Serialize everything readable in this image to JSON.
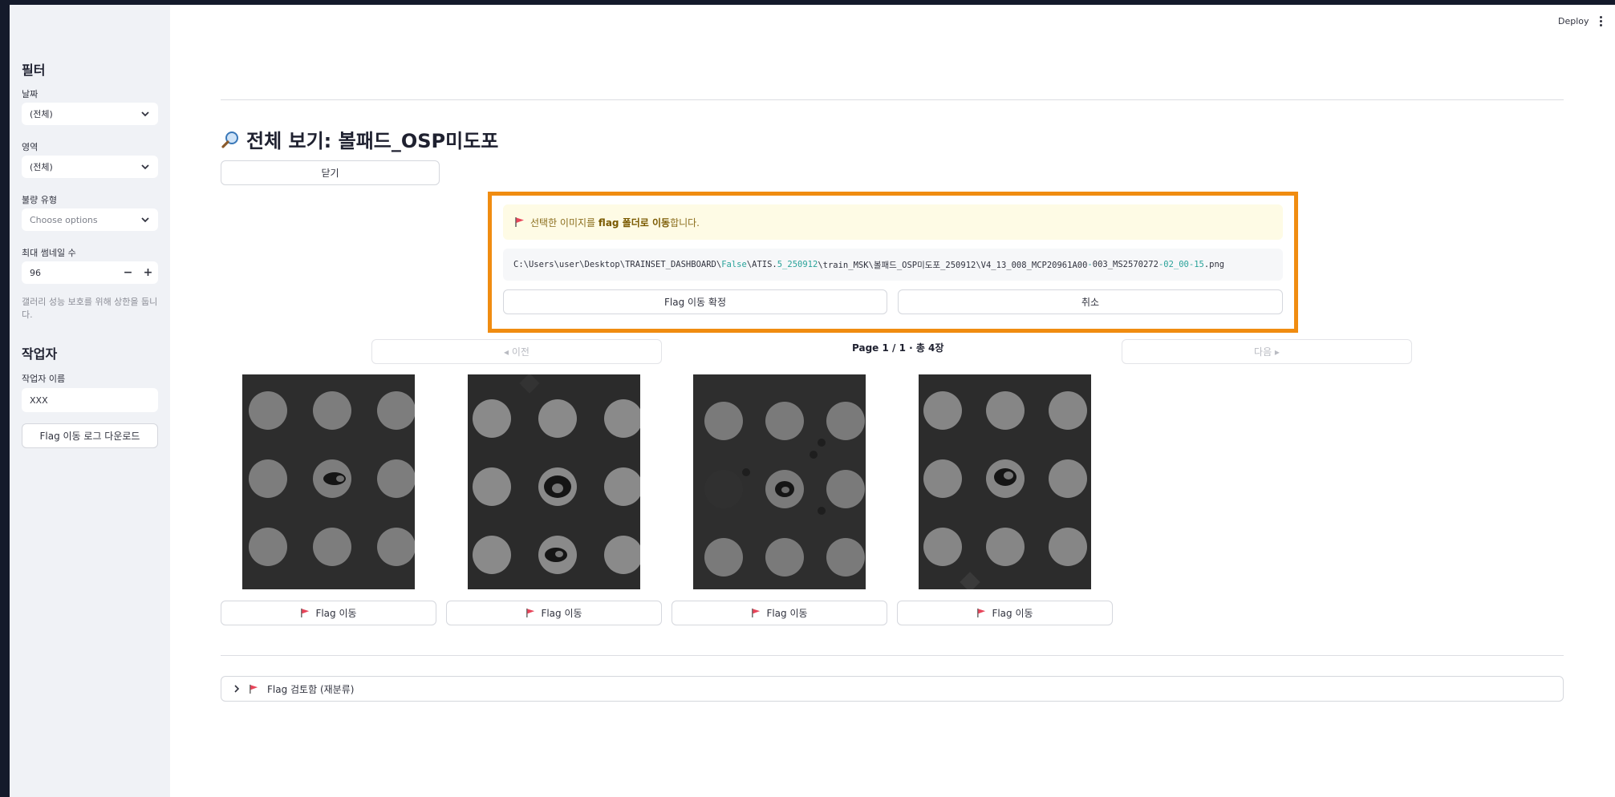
{
  "header": {
    "deploy_label": "Deploy"
  },
  "sidebar": {
    "filter_heading": "필터",
    "date_label": "날짜",
    "date_value": "(전체)",
    "area_label": "영역",
    "area_value": "(전체)",
    "defect_label": "불량 유형",
    "defect_placeholder": "Choose options",
    "max_thumbs_label": "최대 썸네일 수",
    "max_thumbs_value": "96",
    "help_text": "갤러리 성능 보호를 위해 상한을 둡니다.",
    "worker_heading": "작업자",
    "worker_name_label": "작업자 이름",
    "worker_name_value": "XXX",
    "download_button": "Flag 이동 로그 다운로드"
  },
  "main": {
    "title": "전체 보기: 볼패드_OSP미도포",
    "close_button": "닫기",
    "confirm": {
      "notice_prefix": "선택한 이미지를 ",
      "notice_bold": "flag 폴더로 이동",
      "notice_suffix": "합니다.",
      "path_a": "C:\\Users\\user\\Desktop\\TRAINSET_DASHBOARD\\",
      "path_b": "False",
      "path_c": "\\ATIS.",
      "path_d": "5_250912",
      "path_e": "\\train_MSK\\볼패드_OSP미도포_250912\\V4_13_008_MCP20961A00",
      "path_f": "-",
      "path_g": "003_MS2570272",
      "path_h": "-02_00-15",
      "path_i": ".png",
      "confirm_button": "Flag 이동 확정",
      "cancel_button": "취소"
    },
    "pager": {
      "prev_label": "◂ 이전",
      "page_label": "Page 1 / 1 · 총 4장",
      "next_label": "다음 ▸"
    },
    "flag_button_label": "Flag 이동",
    "expander_label": "Flag 검토함 (재분류)"
  },
  "colors": {
    "highlight_border": "#f08c11",
    "flag_icon": "#e8455a",
    "sidebar_bg": "#f0f2f6"
  }
}
